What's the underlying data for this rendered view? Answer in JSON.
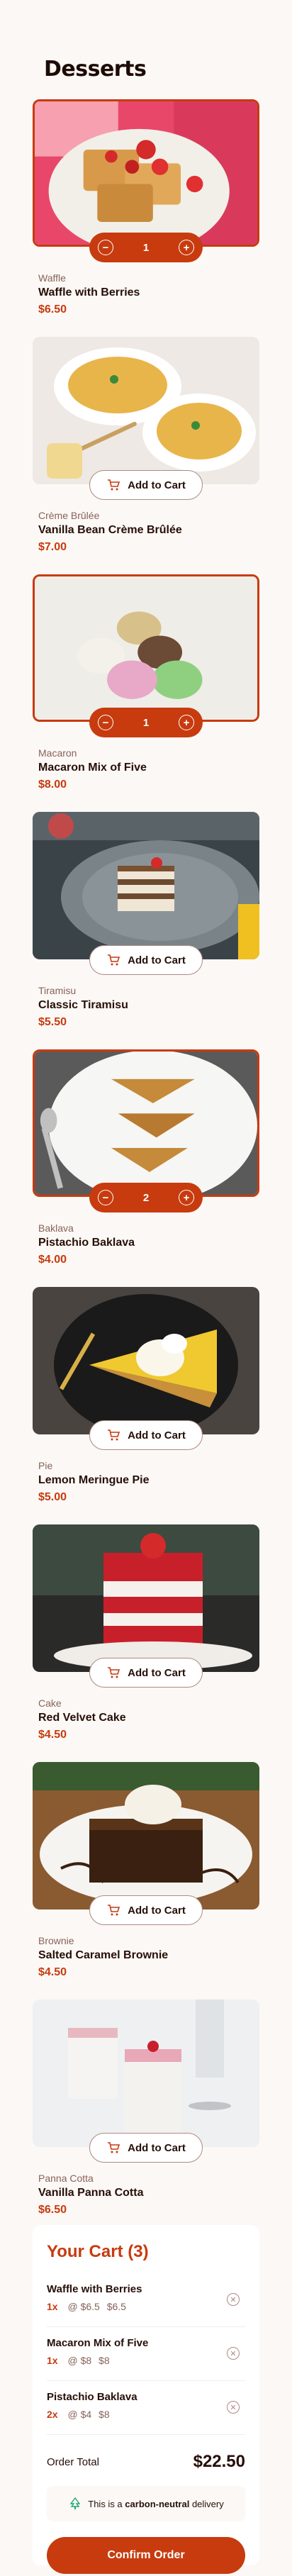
{
  "page": {
    "title": "Desserts"
  },
  "add_label": "Add to Cart",
  "products": [
    {
      "category": "Waffle",
      "name": "Waffle with Berries",
      "price": "$6.50",
      "state": "qty",
      "qty": "1"
    },
    {
      "category": "Crème Brûlée",
      "name": "Vanilla Bean Crème Brûlée",
      "price": "$7.00",
      "state": "add"
    },
    {
      "category": "Macaron",
      "name": "Macaron Mix of Five",
      "price": "$8.00",
      "state": "qty",
      "qty": "1"
    },
    {
      "category": "Tiramisu",
      "name": "Classic Tiramisu",
      "price": "$5.50",
      "state": "add"
    },
    {
      "category": "Baklava",
      "name": "Pistachio Baklava",
      "price": "$4.00",
      "state": "qty",
      "qty": "2"
    },
    {
      "category": "Pie",
      "name": "Lemon Meringue Pie",
      "price": "$5.00",
      "state": "add"
    },
    {
      "category": "Cake",
      "name": "Red Velvet Cake",
      "price": "$4.50",
      "state": "add"
    },
    {
      "category": "Brownie",
      "name": "Salted Caramel Brownie",
      "price": "$4.50",
      "state": "add"
    },
    {
      "category": "Panna Cotta",
      "name": "Vanilla Panna Cotta",
      "price": "$6.50",
      "state": "add"
    }
  ],
  "cart": {
    "title": "Your Cart (3)",
    "items": [
      {
        "name": "Waffle with Berries",
        "qty": "1x",
        "each": "@ $6.5",
        "total": "$6.5"
      },
      {
        "name": "Macaron Mix of Five",
        "qty": "1x",
        "each": "@ $8",
        "total": "$8"
      },
      {
        "name": "Pistachio Baklava",
        "qty": "2x",
        "each": "@ $4",
        "total": "$8"
      }
    ],
    "total_label": "Order Total",
    "total_value": "$22.50",
    "carbon_prefix": "This is a",
    "carbon_bold": "carbon-neutral",
    "carbon_suffix": "delivery",
    "confirm_label": "Confirm Order"
  },
  "colors": {
    "accent": "#c73b0f",
    "text": "#260f08",
    "muted": "#87635a",
    "bg": "#fcf8f5"
  }
}
